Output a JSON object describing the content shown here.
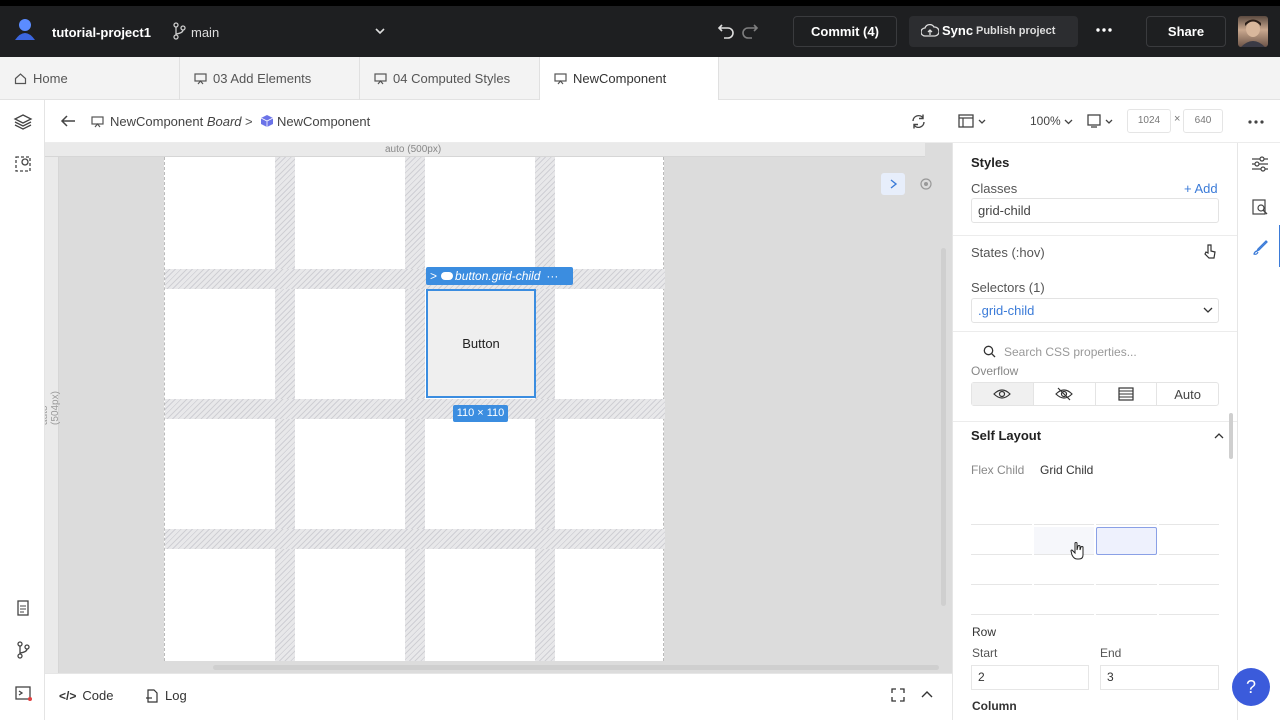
{
  "topbar": {
    "project_name": "tutorial-project1",
    "branch": "main",
    "commit_label": "Commit (4)",
    "sync_label": "Sync",
    "publish_label": "Publish project",
    "share_label": "Share"
  },
  "tabs": [
    {
      "label": "Home"
    },
    {
      "label": "03 Add Elements"
    },
    {
      "label": "04 Computed Styles"
    },
    {
      "label": "NewComponent"
    }
  ],
  "toolbar": {
    "crumb_board_name": "NewComponent",
    "crumb_board_suffix": "Board",
    "crumb_sep": ">",
    "crumb_component": "NewComponent",
    "zoom": "100%",
    "width": "1024",
    "times": "×",
    "height": "640"
  },
  "canvas": {
    "ruler_top_label": "auto (500px)",
    "ruler_left_label": "auto (504px)",
    "selected_tag": "button.grid-child",
    "selected_tag_dots": "···",
    "selected_chev": ">",
    "button_text": "Button",
    "size_badge": "110 × 110"
  },
  "bottombar": {
    "code_label": "Code",
    "code_glyph": "</>",
    "log_label": "Log"
  },
  "styles_panel": {
    "title": "Styles",
    "classes_label": "Classes",
    "add_label": "+ Add",
    "class_value": "grid-child",
    "states_label": "States (:hov)",
    "selectors_label": "Selectors (1)",
    "selector_value": ".grid-child",
    "search_placeholder": "Search CSS properties...",
    "overflow_label": "Overflow",
    "overflow_auto": "Auto",
    "self_layout_title": "Self Layout",
    "flex_child_tab": "Flex Child",
    "grid_child_tab": "Grid Child",
    "row_label": "Row",
    "start_label": "Start",
    "end_label": "End",
    "start_value": "2",
    "end_value": "3",
    "column_label": "Column"
  },
  "help": {
    "label": "?"
  },
  "colors": {
    "accent": "#3b8de0",
    "link": "#3b7bd8",
    "topbar_bg": "#1e1f21",
    "help_bg": "#3b5bdb"
  }
}
